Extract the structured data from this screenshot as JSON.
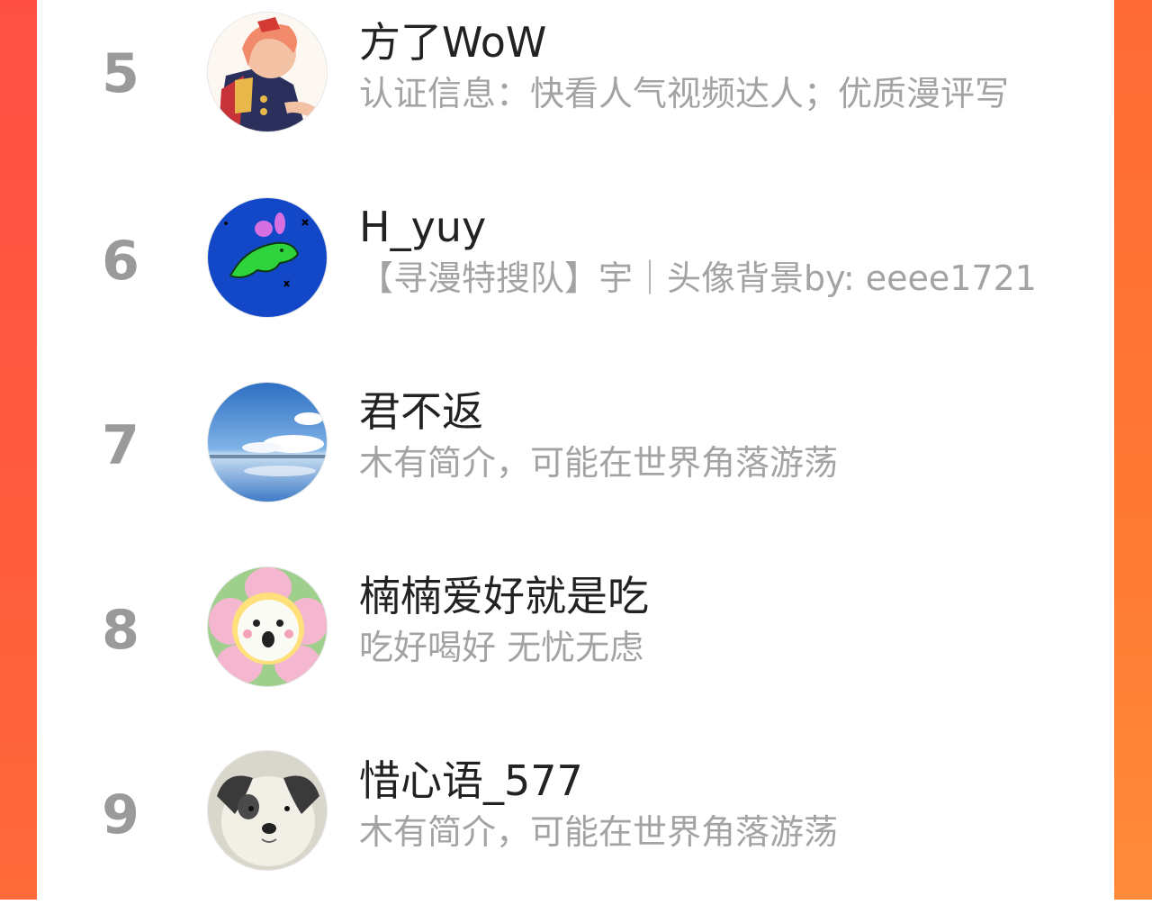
{
  "colors": {
    "frame_left": "#ff5040",
    "frame_right": "#ff7a33",
    "rank_gray": "#9a9a9a",
    "name_text": "#222222",
    "desc_text": "#a3a3a3"
  },
  "ranking": {
    "items": [
      {
        "rank": "5",
        "name": "方了WoW",
        "desc": "认证信息：快看人气视频达人；优质漫评写",
        "avatar_icon": "anime-character-avatar"
      },
      {
        "rank": "6",
        "name": "H_yuy",
        "desc": "【寻漫特搜队】宇｜头像背景by: eeee1721",
        "avatar_icon": "green-bunny-avatar"
      },
      {
        "rank": "7",
        "name": "君不返",
        "desc": "木有简介，可能在世界角落游荡",
        "avatar_icon": "sky-lake-avatar"
      },
      {
        "rank": "8",
        "name": "楠楠爱好就是吃",
        "desc": "吃好喝好 无忧无虑",
        "avatar_icon": "flower-plush-avatar"
      },
      {
        "rank": "9",
        "name": "惜心语_577",
        "desc": "木有简介，可能在世界角落游荡",
        "avatar_icon": "dog-avatar"
      }
    ]
  }
}
